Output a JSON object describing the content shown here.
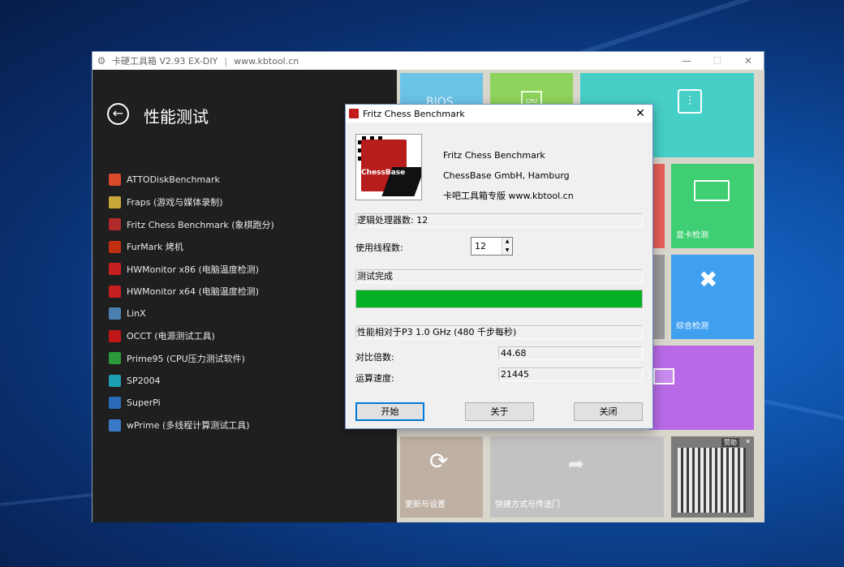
{
  "main_window": {
    "title": "卡硬工具箱 V2.93  EX-DIY",
    "separator": "|",
    "url": "www.kbtool.cn",
    "minimize": "—",
    "maximize": "☐",
    "close": "✕"
  },
  "page": {
    "back_icon": "←",
    "title": "性能测试"
  },
  "tools": [
    {
      "label": "ATTODiskBenchmark",
      "icon": "disk-icon",
      "color": "#d84a2a"
    },
    {
      "label": "Fraps  (游戏与媒体录制)",
      "icon": "fraps-icon",
      "color": "#c8a83a"
    },
    {
      "label": "Fritz Chess Benchmark  (象棋跑分)",
      "icon": "chess-icon",
      "color": "#b02a2a"
    },
    {
      "label": "FurMark 烤机",
      "icon": "furmark-icon",
      "color": "#c03010"
    },
    {
      "label": "HWMonitor x86 (电脑温度检测)",
      "icon": "hwmonitor-icon",
      "color": "#c82020"
    },
    {
      "label": "HWMonitor x64 (电脑温度检测)",
      "icon": "hwmonitor-icon",
      "color": "#c82020"
    },
    {
      "label": "LinX",
      "icon": "linx-icon",
      "color": "#4a7fb0"
    },
    {
      "label": "OCCT (电源测试工具)",
      "icon": "occt-icon",
      "color": "#c01818"
    },
    {
      "label": "Prime95 (CPU压力测试软件)",
      "icon": "prime95-icon",
      "color": "#2a9a3a"
    },
    {
      "label": "SP2004",
      "icon": "sp2004-icon",
      "color": "#1aa0b0"
    },
    {
      "label": "SuperPi",
      "icon": "superpi-icon",
      "color": "#2a6ab8"
    },
    {
      "label": "wPrime (多线程计算测试工具)",
      "icon": "wprime-icon",
      "color": "#3a78c8"
    }
  ],
  "tiles": {
    "bios": "BIOS",
    "cpu": "CPU",
    "gpu_label": "显卡检测",
    "tools_label": "综合检测",
    "update_label": "更新与设置",
    "shortcut_label": "快捷方式与传送门",
    "sponsor": "赞助",
    "sponsor_close": "✕"
  },
  "dialog": {
    "title": "Fritz Chess Benchmark",
    "close": "✕",
    "logo_text": "ChessBase",
    "info": [
      "Fritz Chess Benchmark",
      "ChessBase GmbH, Hamburg",
      "卡吧工具箱专版 www.kbtool.cn"
    ],
    "logical_processors": "逻辑处理器数: 12",
    "threads_label": "使用线程数:",
    "threads_value": "12",
    "status": "测试完成",
    "progress": 1.0,
    "relative_label": "性能相对于P3 1.0 GHz (480 千步每秒)",
    "ratio_label": "对比倍数:",
    "ratio_value": "44.68",
    "speed_label": "运算速度:",
    "speed_value": "21445",
    "buttons": {
      "start": "开始",
      "about": "关于",
      "close": "关闭"
    }
  }
}
